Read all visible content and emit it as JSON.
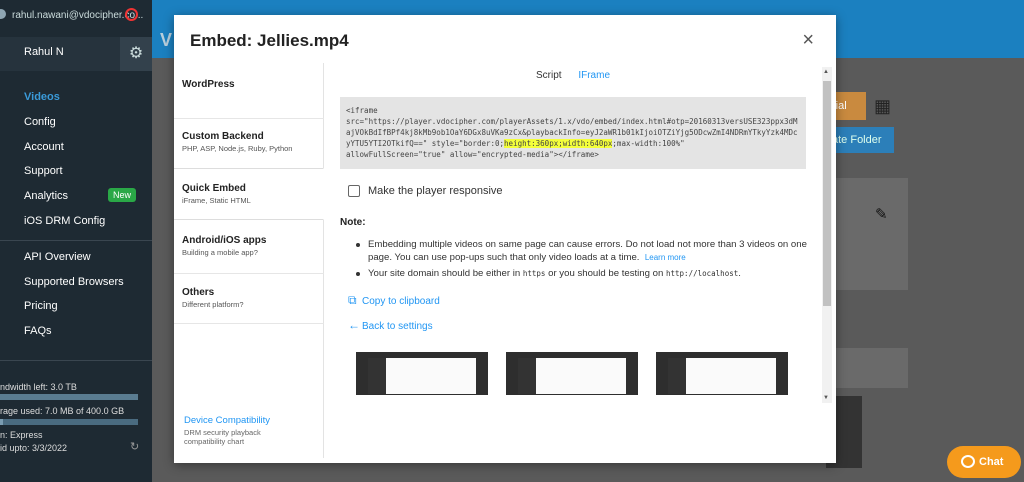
{
  "sidebar": {
    "email": "rahul.nawani@vdocipher.co...",
    "user": "Rahul N",
    "nav": [
      {
        "label": "Videos",
        "active": true
      },
      {
        "label": "Config"
      },
      {
        "label": "Account"
      },
      {
        "label": "Support"
      },
      {
        "label": "Analytics",
        "badge": "New"
      },
      {
        "label": "iOS DRM Config"
      },
      {
        "label": "API Overview"
      },
      {
        "label": "Supported Browsers"
      },
      {
        "label": "Pricing"
      },
      {
        "label": "FAQs"
      }
    ],
    "bandwidth": "ndwidth left: 3.0 TB",
    "storage": "rage used: 7.0 MB of 400.0 GB",
    "plan": "n: Express",
    "valid": "id upto: 3/3/2022"
  },
  "background": {
    "page_title": "V",
    "tutorial_label": "rial",
    "folder_label": "ate Folder"
  },
  "modal": {
    "title": "Embed: Jellies.mp4",
    "close": "×",
    "left_nav": [
      {
        "title": "WordPress",
        "sub": ""
      },
      {
        "title": "Custom Backend",
        "sub": "PHP, ASP, Node.js, Ruby, Python"
      },
      {
        "title": "Quick Embed",
        "sub": "iFrame, Static HTML",
        "selected": true
      },
      {
        "title": "Android/iOS apps",
        "sub": "Building a mobile app?"
      },
      {
        "title": "Others",
        "sub": "Different platform?"
      }
    ],
    "device_compat": {
      "title": "Device Compatibility",
      "sub": "DRM security playback compatibility chart"
    },
    "tabs": [
      {
        "label": "Script"
      },
      {
        "label": "IFrame",
        "active": true
      }
    ],
    "code": {
      "part1": "<iframe\nsrc=\"https://player.vdocipher.com/playerAssets/1.x/vdo/embed/index.html#otp=20160313versUSE323ppx3dMajVOkBdIfBPf4kj8kMb9ob1OaY6DGx8uVKa9zCx&playbackInfo=eyJ2aWR1b01kIjoiOTZiYjg5ODcwZmI4NDRmYTkyYzk4MDcyYTU5YTI2OTkifQ==\" style=\"border:0;",
      "hl1": "height:360px;width:640px",
      "part2": ";max-width:100%\"\nallowFullScreen=\"true\" allow=\"encrypted-media\"></iframe>"
    },
    "responsive_label": "Make the player responsive",
    "note_label": "Note:",
    "bullet1": "Embedding multiple videos on same page can cause errors. Do not load not more than 3 videos on one page. You can use pop-ups such that only video loads at a time.",
    "learn_more": "Learn more",
    "bullet2_a": "Your site domain should be either in",
    "bullet2_b": "https",
    "bullet2_c": "or you should be testing on",
    "bullet2_d": "http://localhost",
    "copy_label": "Copy to clipboard",
    "back_label": "Back to settings"
  },
  "chat_label": "Chat",
  "colors": {
    "accent": "#2196f3",
    "sidebar": "#1e2a33",
    "highlight": "#f4ff3a",
    "chat": "#f59a1c"
  }
}
